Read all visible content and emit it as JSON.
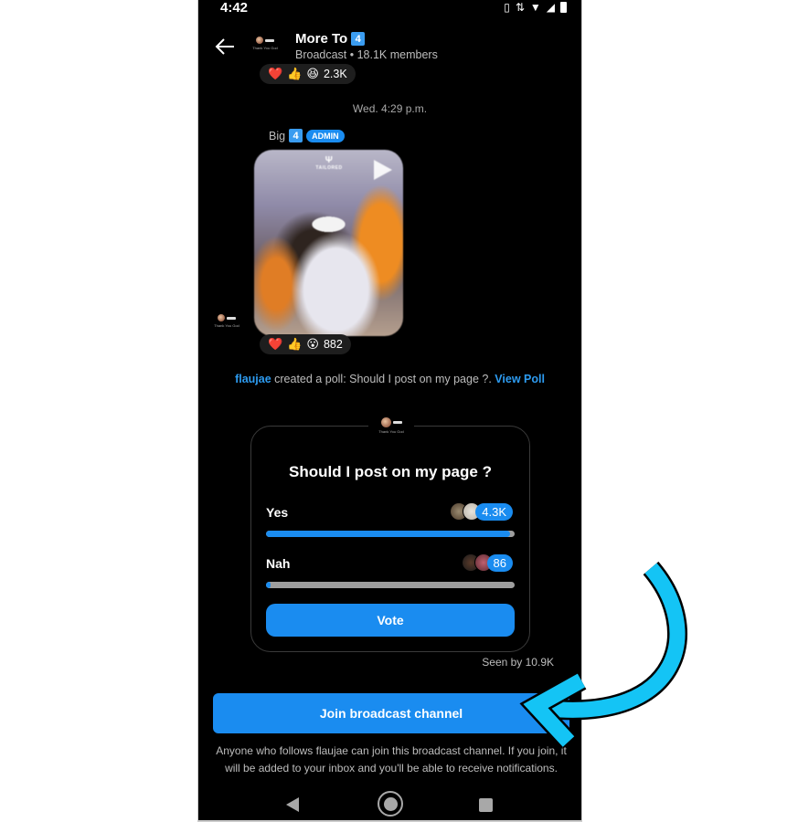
{
  "status_bar": {
    "time": "4:42",
    "icons": [
      "vibrate-icon",
      "data-arrows-icon",
      "wifi-icon",
      "signal-icon",
      "battery-icon"
    ]
  },
  "header": {
    "back_icon": "arrow-left-icon",
    "title": "More To",
    "title_emoji": "4",
    "subtitle": "Broadcast • 18.1K members",
    "avatar_caption": "Thank You God"
  },
  "messages": {
    "prev_reactions": {
      "emojis": [
        "❤️",
        "👍",
        "😆"
      ],
      "count": "2.3K"
    },
    "timestamp": "Wed. 4:29 p.m.",
    "sender": {
      "name": "Big",
      "name_emoji": "4",
      "badge": "ADMIN"
    },
    "video": {
      "logo_text": "TAILORED",
      "play_icon": "play-icon"
    },
    "video_reactions": {
      "emojis": [
        "❤️",
        "👍",
        "😮"
      ],
      "count": "882"
    },
    "side_avatar_caption": "Thank You God"
  },
  "poll_note": {
    "user": "flaujae",
    "text": " created a poll: Should I post on my page ?. ",
    "link": "View Poll"
  },
  "poll": {
    "avatar_caption": "Thank You God",
    "question": "Should I post on my page ?",
    "options": [
      {
        "label": "Yes",
        "count": "4.3K",
        "fill_percent": 98
      },
      {
        "label": "Nah",
        "count": "86",
        "fill_percent": 2
      }
    ],
    "vote_label": "Vote",
    "seen_by": "Seen by 10.9K"
  },
  "join": {
    "button_label": "Join broadcast channel",
    "note": "Anyone who follows flaujae can join this broadcast channel. If you join, it will be added to your inbox and you'll be able to receive notifications."
  },
  "nav_bar": {
    "icons": [
      "nav-back-icon",
      "nav-home-icon",
      "nav-recents-icon"
    ]
  },
  "colors": {
    "accent": "#1a8cf0",
    "background": "#000000",
    "annotation_arrow": "#14c4f5"
  }
}
